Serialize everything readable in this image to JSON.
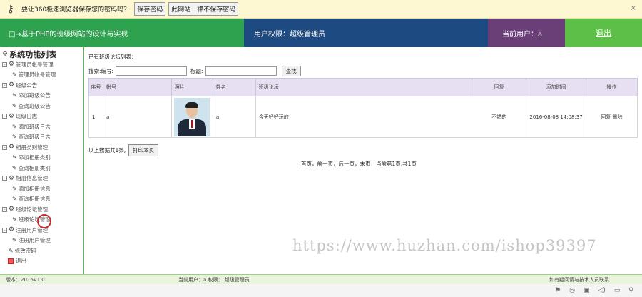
{
  "pwbar": {
    "key_icon": "key-icon",
    "message": "要让360极速浏览器保存您的密码吗？",
    "save_btn": "保存密码",
    "never_btn": "此网站一律不保存密码",
    "close": "×"
  },
  "header": {
    "system_title": "□→基于PHP的班级网站的设计与实现",
    "permission": "用户权限：超级管理员",
    "current_user": "当前用户：a",
    "logout": "退出",
    "colors": {
      "system": "#2ea24e",
      "permission": "#1d4a80",
      "user": "#6a3f78",
      "logout": "#5dbf47"
    }
  },
  "sidebar": {
    "title": "系统功能列表",
    "groups": [
      {
        "label": "管理员帐号管理",
        "items": [
          "管理员帐号管理"
        ]
      },
      {
        "label": "班级公告",
        "items": [
          "添加班级公告",
          "查询班级公告"
        ]
      },
      {
        "label": "班级日志",
        "items": [
          "添加班级日志",
          "查询班级日志"
        ]
      },
      {
        "label": "相册类别管理",
        "items": [
          "添加相册类别",
          "查询相册类别"
        ]
      },
      {
        "label": "相册信息管理",
        "items": [
          "添加相册信息",
          "查询相册信息"
        ]
      },
      {
        "label": "班级论坛管理",
        "items": [
          "班级论坛管理"
        ]
      },
      {
        "label": "注册用户管理",
        "items": [
          "注册用户管理"
        ]
      }
    ],
    "extra": [
      "修改密码",
      "退出"
    ]
  },
  "main": {
    "caption": "已有班级论坛列表：",
    "search": {
      "label": "搜索:",
      "field1": "编号:",
      "field2": "标题:",
      "button": "查找"
    },
    "table": {
      "headers": [
        "序号",
        "帐号",
        "照片",
        "姓名",
        "班级论坛",
        "回复",
        "添加时间",
        "操作"
      ],
      "rows": [
        {
          "seq": "1",
          "account": "a",
          "name": "a",
          "topic": "今天好好玩的",
          "reply": "不错的",
          "time": "2016-08-08 14:08:37",
          "action_reply": "回复",
          "action_delete": "删除"
        }
      ]
    },
    "total": "以上数据共1条,",
    "print_btn": "打印本页",
    "pager": "首页，前一页，后一页，末页，当前第1页,共1页",
    "watermark": "https://www.huzhan.com/ishop39397"
  },
  "footer": {
    "version": "版本：2016V1.0",
    "current": "当前用户：a  权限：  超级管理员",
    "contact": "如有疑问请与技术人员联系"
  },
  "tray": [
    "⚑",
    "◎",
    "▣",
    "◁)",
    "▭",
    "⚲"
  ]
}
